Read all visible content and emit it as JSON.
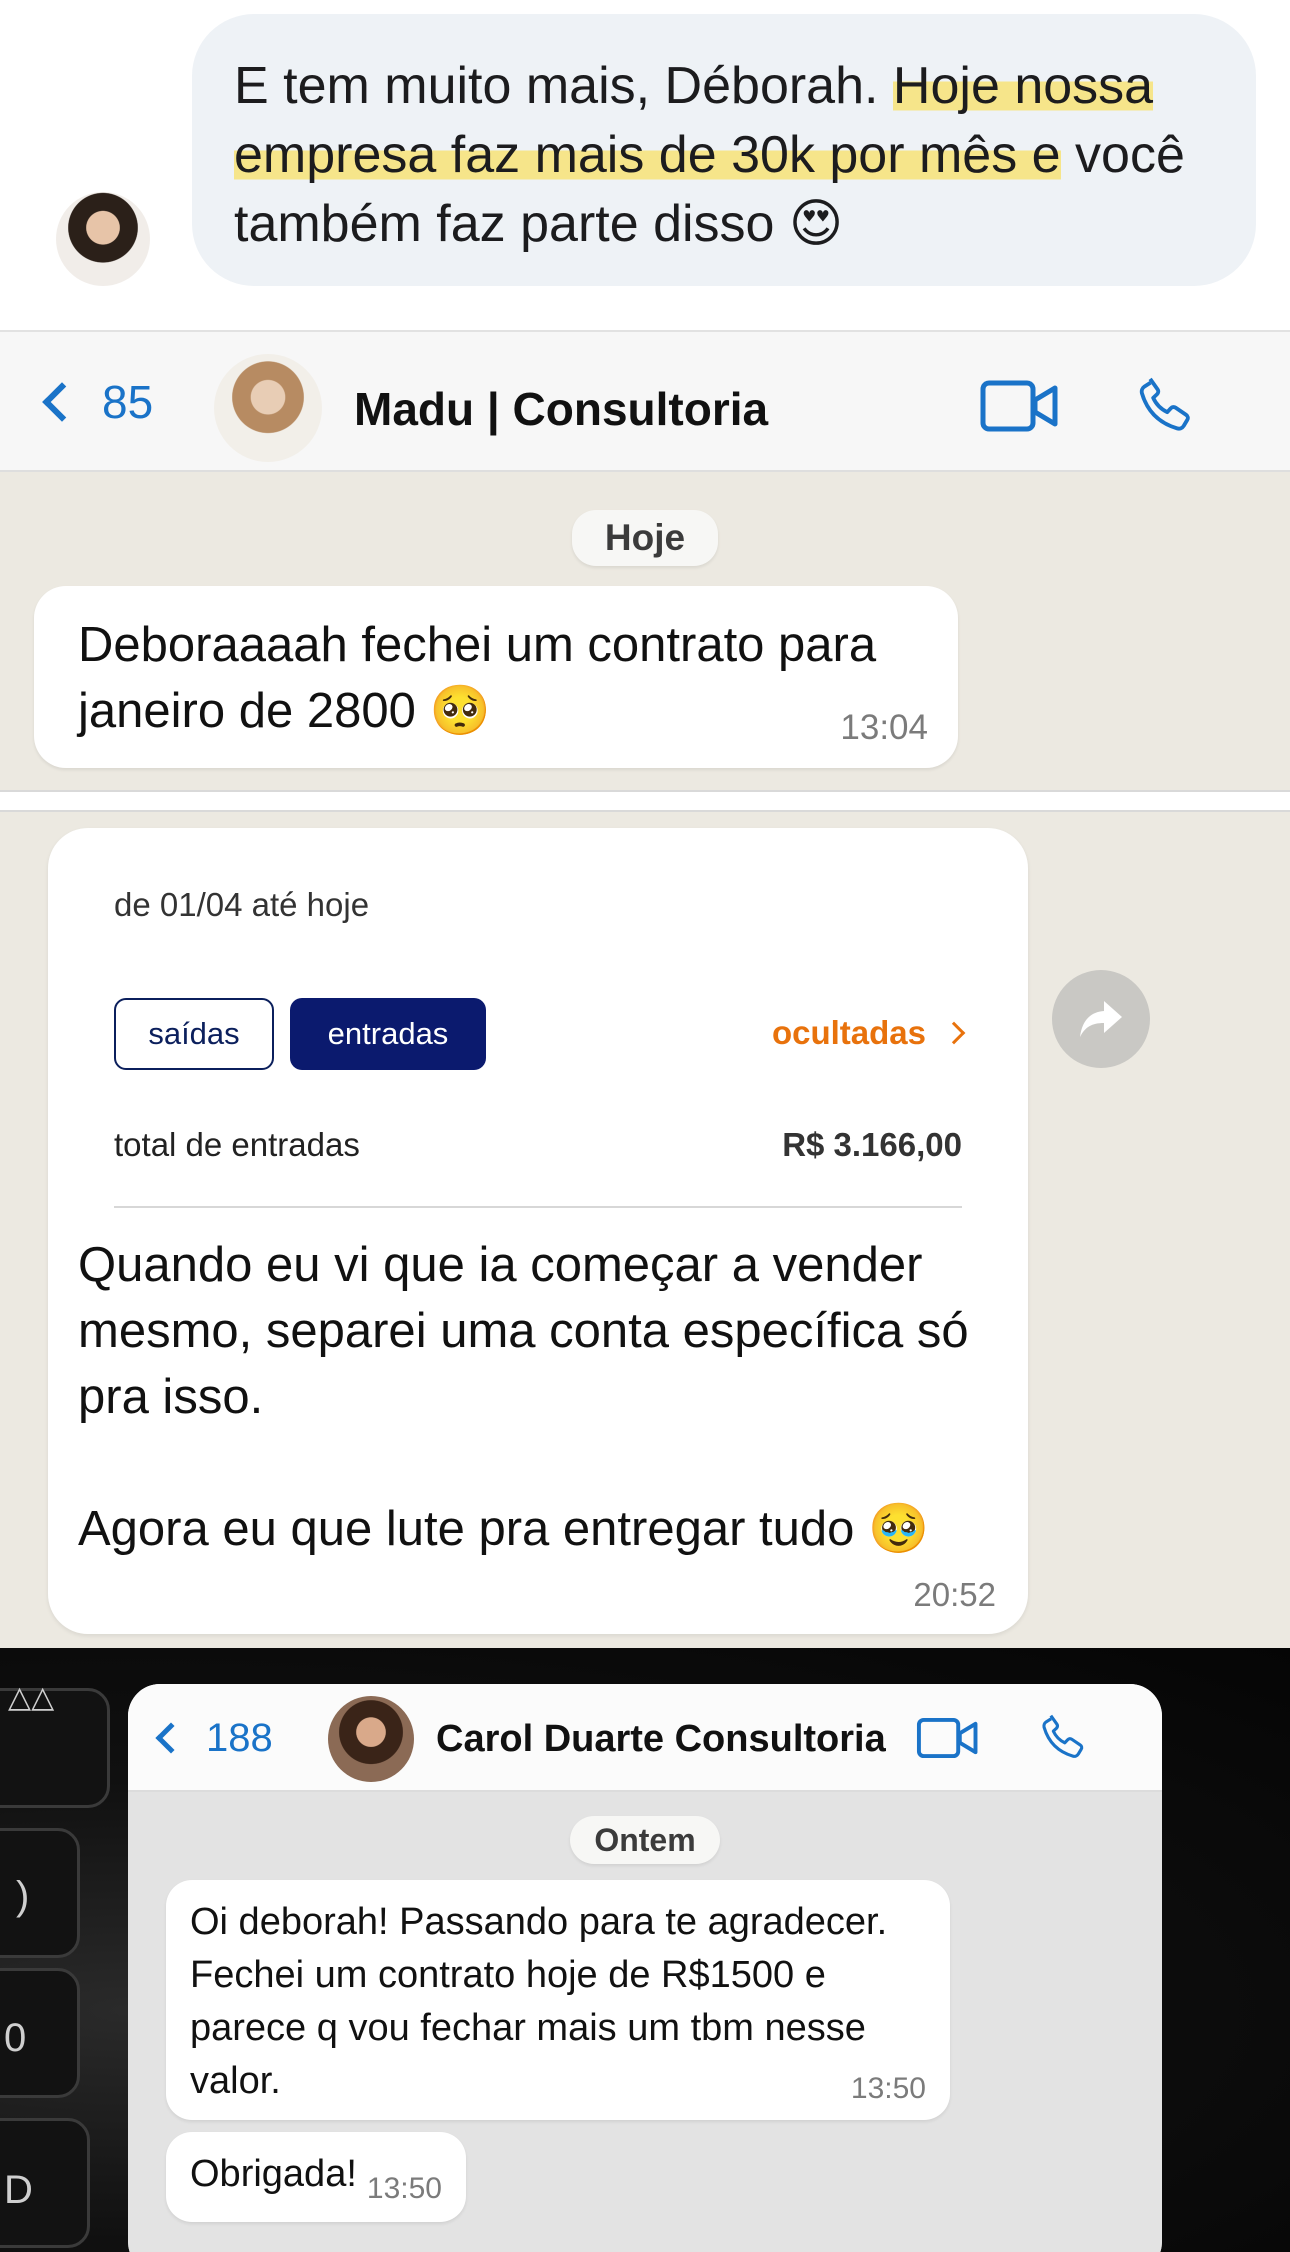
{
  "quote": {
    "text_before": "E tem muito mais, Déborah. ",
    "text_highlight": "Hoje nossa empresa faz mais de 30k por mês e",
    "text_after": " você também faz parte disso",
    "emoji": "😍"
  },
  "chat1": {
    "back_count": "85",
    "contact": "Madu | Consultoria",
    "icons": [
      "chevron-left-icon",
      "video-call-icon",
      "phone-call-icon"
    ],
    "date_chip": "Hoje",
    "message": {
      "text": "Deboraaaah fechei um contrato para janeiro de 2800",
      "emoji": "🥺",
      "time": "13:04"
    }
  },
  "bank": {
    "range": "de 01/04 até hoje",
    "tab_out": "saídas",
    "tab_in": "entradas",
    "hidden_link": "ocultadas",
    "total_label": "total de entradas",
    "total_value": "R$ 3.166,00",
    "message_p1": "Quando eu vi que ia começar a vender mesmo, separei uma conta específica só pra isso.",
    "message_p2": "Agora eu que lute pra entregar tudo",
    "emoji": "🥹",
    "time": "20:52"
  },
  "chat2": {
    "back_count": "188",
    "contact": "Carol Duarte Consultoria",
    "date_chip": "Ontem",
    "message1": {
      "text": "Oi deborah! Passando para te agradecer. Fechei um contrato hoje de R$1500 e parece q vou fechar mais um tbm nesse valor.",
      "time": "13:50"
    },
    "message2": {
      "text": "Obrigada!",
      "time": "13:50"
    }
  },
  "colors": {
    "ios_blue": "#1a73c8",
    "bank_navy": "#0b1a6e",
    "bank_orange": "#e8720c",
    "highlight_yellow": "#f6e58a",
    "chat_background": "#ece9e1"
  }
}
